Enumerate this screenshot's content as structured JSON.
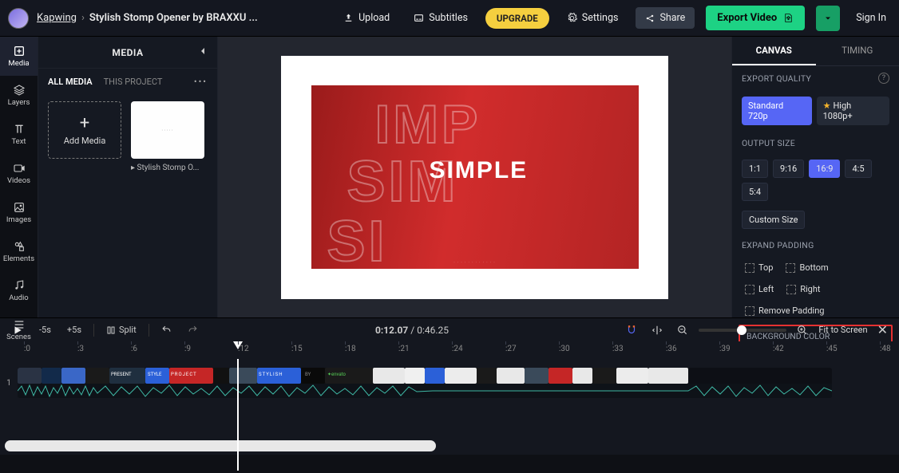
{
  "breadcrumb": {
    "root": "Kapwing",
    "project": "Stylish Stomp Opener by BRAXXU ..."
  },
  "topbar": {
    "upload": "Upload",
    "subtitles": "Subtitles",
    "upgrade": "UPGRADE",
    "settings": "Settings",
    "share": "Share",
    "export": "Export Video",
    "signin": "Sign In"
  },
  "leftrail": {
    "items": [
      {
        "label": "Media"
      },
      {
        "label": "Layers"
      },
      {
        "label": "Text"
      },
      {
        "label": "Videos"
      },
      {
        "label": "Images"
      },
      {
        "label": "Elements"
      },
      {
        "label": "Audio"
      },
      {
        "label": "Scenes"
      }
    ]
  },
  "mediapanel": {
    "title": "MEDIA",
    "tabs": {
      "all": "ALL MEDIA",
      "project": "THIS PROJECT"
    },
    "add": "Add Media",
    "thumb_label": "Stylish Stomp O...",
    "thumb_inner": "·····"
  },
  "canvas": {
    "outline1": "IMP",
    "outline2": "SIM",
    "outline3": "SI",
    "solid": "SIMPLE"
  },
  "rightpanel": {
    "tabs": {
      "canvas": "CANVAS",
      "timing": "TIMING"
    },
    "export_quality": "EXPORT QUALITY",
    "quality_standard": "Standard 720p",
    "quality_high": "High 1080p+",
    "output_size": "OUTPUT SIZE",
    "sizes": [
      "1:1",
      "9:16",
      "16:9",
      "4:5",
      "5:4"
    ],
    "custom_size": "Custom Size",
    "expand_padding": "EXPAND PADDING",
    "pad": {
      "top": "Top",
      "bottom": "Bottom",
      "left": "Left",
      "right": "Right",
      "remove": "Remove Padding"
    },
    "background_color": "BACKGROUND COLOR",
    "bg_hex": "#ffffff",
    "swatches": [
      "#000000",
      "#ffffff",
      "#e63146",
      "#f5cf2b",
      "#2b7fd9"
    ]
  },
  "timeline": {
    "back5": "-5s",
    "fwd5": "+5s",
    "split": "Split",
    "current": "0:12.07",
    "total": "0:46.25",
    "fit": "Fit to Screen",
    "ruler": [
      ":0",
      ":3",
      ":6",
      ":9",
      ":12",
      ":15",
      ":18",
      ":21",
      ":24",
      ":27",
      ":30",
      ":33",
      ":36",
      ":39",
      ":42",
      ":45",
      ":48"
    ],
    "track_number": "1"
  }
}
